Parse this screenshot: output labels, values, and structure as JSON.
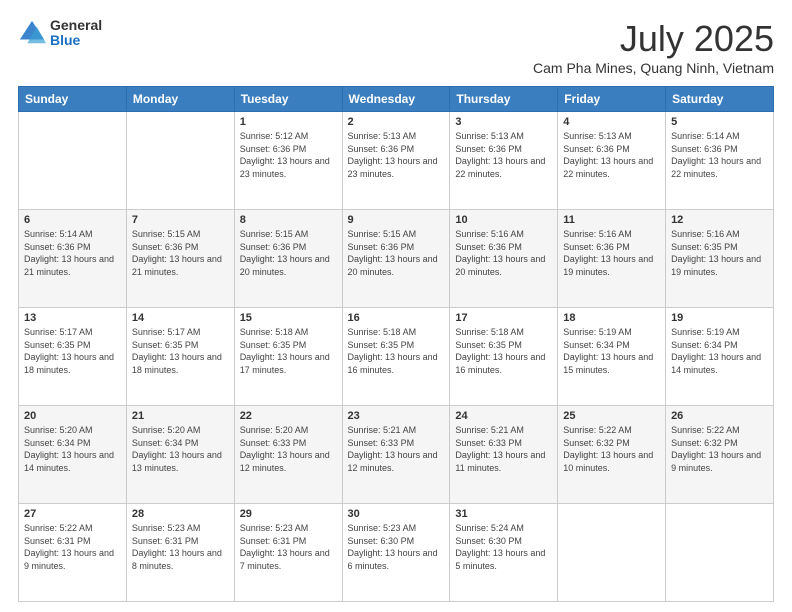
{
  "logo": {
    "general": "General",
    "blue": "Blue"
  },
  "header": {
    "month": "July 2025",
    "location": "Cam Pha Mines, Quang Ninh, Vietnam"
  },
  "weekdays": [
    "Sunday",
    "Monday",
    "Tuesday",
    "Wednesday",
    "Thursday",
    "Friday",
    "Saturday"
  ],
  "weeks": [
    [
      {
        "day": "",
        "info": ""
      },
      {
        "day": "",
        "info": ""
      },
      {
        "day": "1",
        "info": "Sunrise: 5:12 AM\nSunset: 6:36 PM\nDaylight: 13 hours and 23 minutes."
      },
      {
        "day": "2",
        "info": "Sunrise: 5:13 AM\nSunset: 6:36 PM\nDaylight: 13 hours and 23 minutes."
      },
      {
        "day": "3",
        "info": "Sunrise: 5:13 AM\nSunset: 6:36 PM\nDaylight: 13 hours and 22 minutes."
      },
      {
        "day": "4",
        "info": "Sunrise: 5:13 AM\nSunset: 6:36 PM\nDaylight: 13 hours and 22 minutes."
      },
      {
        "day": "5",
        "info": "Sunrise: 5:14 AM\nSunset: 6:36 PM\nDaylight: 13 hours and 22 minutes."
      }
    ],
    [
      {
        "day": "6",
        "info": "Sunrise: 5:14 AM\nSunset: 6:36 PM\nDaylight: 13 hours and 21 minutes."
      },
      {
        "day": "7",
        "info": "Sunrise: 5:15 AM\nSunset: 6:36 PM\nDaylight: 13 hours and 21 minutes."
      },
      {
        "day": "8",
        "info": "Sunrise: 5:15 AM\nSunset: 6:36 PM\nDaylight: 13 hours and 20 minutes."
      },
      {
        "day": "9",
        "info": "Sunrise: 5:15 AM\nSunset: 6:36 PM\nDaylight: 13 hours and 20 minutes."
      },
      {
        "day": "10",
        "info": "Sunrise: 5:16 AM\nSunset: 6:36 PM\nDaylight: 13 hours and 20 minutes."
      },
      {
        "day": "11",
        "info": "Sunrise: 5:16 AM\nSunset: 6:36 PM\nDaylight: 13 hours and 19 minutes."
      },
      {
        "day": "12",
        "info": "Sunrise: 5:16 AM\nSunset: 6:35 PM\nDaylight: 13 hours and 19 minutes."
      }
    ],
    [
      {
        "day": "13",
        "info": "Sunrise: 5:17 AM\nSunset: 6:35 PM\nDaylight: 13 hours and 18 minutes."
      },
      {
        "day": "14",
        "info": "Sunrise: 5:17 AM\nSunset: 6:35 PM\nDaylight: 13 hours and 18 minutes."
      },
      {
        "day": "15",
        "info": "Sunrise: 5:18 AM\nSunset: 6:35 PM\nDaylight: 13 hours and 17 minutes."
      },
      {
        "day": "16",
        "info": "Sunrise: 5:18 AM\nSunset: 6:35 PM\nDaylight: 13 hours and 16 minutes."
      },
      {
        "day": "17",
        "info": "Sunrise: 5:18 AM\nSunset: 6:35 PM\nDaylight: 13 hours and 16 minutes."
      },
      {
        "day": "18",
        "info": "Sunrise: 5:19 AM\nSunset: 6:34 PM\nDaylight: 13 hours and 15 minutes."
      },
      {
        "day": "19",
        "info": "Sunrise: 5:19 AM\nSunset: 6:34 PM\nDaylight: 13 hours and 14 minutes."
      }
    ],
    [
      {
        "day": "20",
        "info": "Sunrise: 5:20 AM\nSunset: 6:34 PM\nDaylight: 13 hours and 14 minutes."
      },
      {
        "day": "21",
        "info": "Sunrise: 5:20 AM\nSunset: 6:34 PM\nDaylight: 13 hours and 13 minutes."
      },
      {
        "day": "22",
        "info": "Sunrise: 5:20 AM\nSunset: 6:33 PM\nDaylight: 13 hours and 12 minutes."
      },
      {
        "day": "23",
        "info": "Sunrise: 5:21 AM\nSunset: 6:33 PM\nDaylight: 13 hours and 12 minutes."
      },
      {
        "day": "24",
        "info": "Sunrise: 5:21 AM\nSunset: 6:33 PM\nDaylight: 13 hours and 11 minutes."
      },
      {
        "day": "25",
        "info": "Sunrise: 5:22 AM\nSunset: 6:32 PM\nDaylight: 13 hours and 10 minutes."
      },
      {
        "day": "26",
        "info": "Sunrise: 5:22 AM\nSunset: 6:32 PM\nDaylight: 13 hours and 9 minutes."
      }
    ],
    [
      {
        "day": "27",
        "info": "Sunrise: 5:22 AM\nSunset: 6:31 PM\nDaylight: 13 hours and 9 minutes."
      },
      {
        "day": "28",
        "info": "Sunrise: 5:23 AM\nSunset: 6:31 PM\nDaylight: 13 hours and 8 minutes."
      },
      {
        "day": "29",
        "info": "Sunrise: 5:23 AM\nSunset: 6:31 PM\nDaylight: 13 hours and 7 minutes."
      },
      {
        "day": "30",
        "info": "Sunrise: 5:23 AM\nSunset: 6:30 PM\nDaylight: 13 hours and 6 minutes."
      },
      {
        "day": "31",
        "info": "Sunrise: 5:24 AM\nSunset: 6:30 PM\nDaylight: 13 hours and 5 minutes."
      },
      {
        "day": "",
        "info": ""
      },
      {
        "day": "",
        "info": ""
      }
    ]
  ]
}
